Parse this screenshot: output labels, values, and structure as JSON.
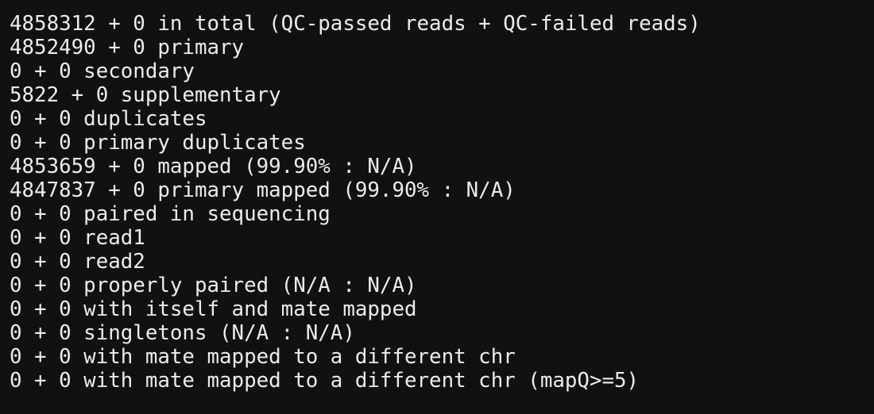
{
  "terminal": {
    "lines": [
      "4858312 + 0 in total (QC-passed reads + QC-failed reads)",
      "4852490 + 0 primary",
      "0 + 0 secondary",
      "5822 + 0 supplementary",
      "0 + 0 duplicates",
      "0 + 0 primary duplicates",
      "4853659 + 0 mapped (99.90% : N/A)",
      "4847837 + 0 primary mapped (99.90% : N/A)",
      "0 + 0 paired in sequencing",
      "0 + 0 read1",
      "0 + 0 read2",
      "0 + 0 properly paired (N/A : N/A)",
      "0 + 0 with itself and mate mapped",
      "0 + 0 singletons (N/A : N/A)",
      "0 + 0 with mate mapped to a different chr",
      "0 + 0 with mate mapped to a different chr (mapQ>=5)"
    ],
    "colors": {
      "background": "#111111",
      "text": "#ececec"
    }
  }
}
